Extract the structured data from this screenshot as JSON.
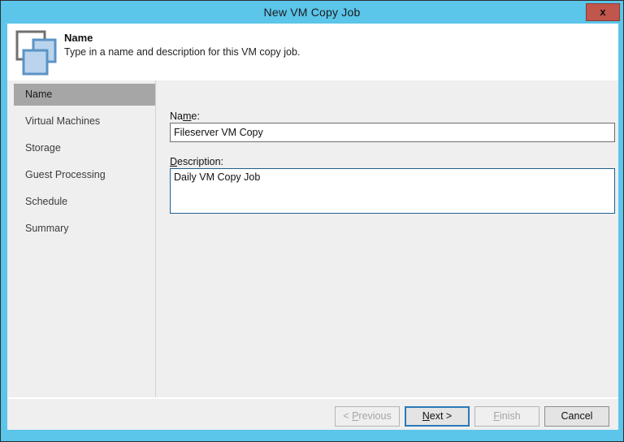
{
  "window": {
    "title": "New VM Copy Job",
    "close_label": "x",
    "titlebar_color": "#5bc5ea",
    "close_button_color": "#c0564c"
  },
  "header": {
    "icon": "vm-copy-job-icon",
    "title": "Name",
    "subtitle": "Type in a name and description for this VM copy job."
  },
  "sidebar": {
    "items": [
      {
        "label": "Name",
        "selected": true
      },
      {
        "label": "Virtual Machines",
        "selected": false
      },
      {
        "label": "Storage",
        "selected": false
      },
      {
        "label": "Guest Processing",
        "selected": false
      },
      {
        "label": "Schedule",
        "selected": false
      },
      {
        "label": "Summary",
        "selected": false
      }
    ],
    "selected_background": "#a6a6a6"
  },
  "form": {
    "name": {
      "label_prefix": "Na",
      "label_accel": "m",
      "label_suffix": "e:",
      "value": "Fileserver VM Copy",
      "placeholder": ""
    },
    "description": {
      "label_accel": "D",
      "label_suffix": "escription:",
      "value": "Daily VM Copy Job",
      "placeholder": "",
      "focused": true,
      "focus_border_color": "#22608f"
    }
  },
  "footer": {
    "buttons": [
      {
        "name": "previous",
        "prefix": "< ",
        "accel": "P",
        "suffix": "revious",
        "state": "disabled"
      },
      {
        "name": "next",
        "prefix": "",
        "accel": "N",
        "suffix": "ext >",
        "state": "default"
      },
      {
        "name": "finish",
        "prefix": "",
        "accel": "F",
        "suffix": "inish",
        "state": "disabled"
      },
      {
        "name": "cancel",
        "prefix": "",
        "accel": "",
        "suffix": "Cancel",
        "state": "enabled"
      }
    ]
  }
}
